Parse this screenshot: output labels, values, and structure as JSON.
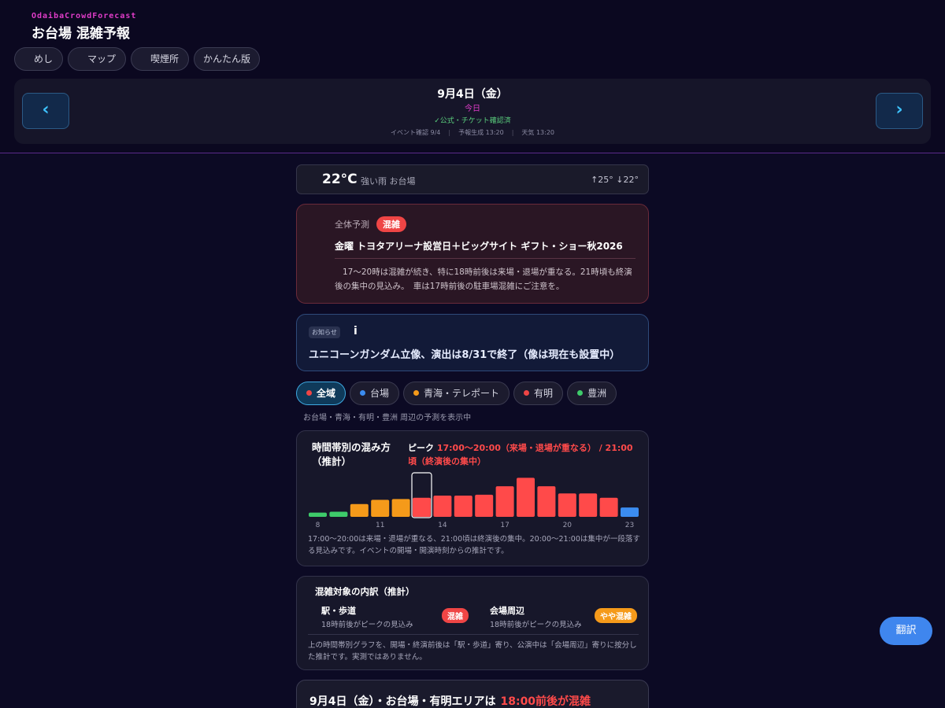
{
  "header": {
    "brand_en": "OdaibaCrowdForecast",
    "brand_ja": "お台場 混雑予報",
    "tabs": [
      {
        "label": "めし"
      },
      {
        "label": "マップ"
      },
      {
        "label": "喫煙所"
      },
      {
        "label": "かんたん版"
      }
    ]
  },
  "date_bar": {
    "prev": "‹",
    "next": "›",
    "date": "9月4日（金）",
    "today": "今日",
    "verified": "✓公式・チケット確認済",
    "event_check": "イベント確認 9/4",
    "forecast_generated": "予報生成 13:20",
    "weather_time": "天気 13:20"
  },
  "weather": {
    "temp": "22°C",
    "desc": "強い雨 お台場",
    "high_low": "↑25° ↓22°"
  },
  "overall": {
    "label": "全体予測",
    "level": "混雑",
    "title": "金曜 トヨタアリーナ設営日＋ビッグサイト ギフト・ショー秋2026",
    "body": "17〜20時は混雑が続き、特に18時前後は来場・退場が重なる。21時頃も終演後の集中の見込み。　車は17時前後の駐車場混雑にご注意を。"
  },
  "notice": {
    "tag": "お知らせ",
    "icon_text": "i",
    "text": "ユニコーンガンダム立像、演出は8/31で終了（像は現在も設置中）"
  },
  "areas": {
    "items": [
      {
        "label": "全域",
        "color": "#ef4545"
      },
      {
        "label": "台場",
        "color": "#3b8cf0"
      },
      {
        "label": "青海・テレポート",
        "color": "#f59a1a"
      },
      {
        "label": "有明",
        "color": "#ef4545"
      },
      {
        "label": "豊洲",
        "color": "#3ecb6a"
      }
    ],
    "note": "お台場・青海・有明・豊洲 周辺の予測を表示中"
  },
  "chart_data": {
    "type": "bar",
    "title": "時間帯別の混み方（推計）",
    "peak_label": "ピーク",
    "peak_value": "17:00〜20:00（来場・退場が重なる） / 21:00頃（終演後の集中）",
    "categories": [
      "8",
      "9",
      "10",
      "11",
      "12",
      "13",
      "14",
      "15",
      "16",
      "17",
      "18",
      "19",
      "20",
      "21",
      "22",
      "23"
    ],
    "values": [
      10,
      12,
      30,
      40,
      42,
      45,
      50,
      50,
      52,
      72,
      92,
      72,
      55,
      55,
      45,
      22
    ],
    "colors": [
      "#3ecb6a",
      "#3ecb6a",
      "#f59a1a",
      "#f59a1a",
      "#f59a1a",
      "#ff4a4a",
      "#ff4a4a",
      "#ff4a4a",
      "#ff4a4a",
      "#ff4a4a",
      "#ff4a4a",
      "#ff4a4a",
      "#ff4a4a",
      "#ff4a4a",
      "#ff4a4a",
      "#3b8cf0"
    ],
    "selected_index": 5,
    "tick_labels": [
      "8",
      "11",
      "14",
      "17",
      "20",
      "23"
    ],
    "ylim": [
      0,
      100
    ],
    "note": "17:00〜20:00は来場・退場が重なる、21:00頃は終演後の集中。20:00〜21:00は集中が一段落する見込みです。イベントの開場・開演時刻からの推計です。"
  },
  "breakdown": {
    "title": "混雑対象の内訳（推計）",
    "items": [
      {
        "name": "駅・歩道",
        "sub": "18時前後がピークの見込み",
        "badge": "混雑",
        "badge_color": "#ef4545"
      },
      {
        "name": "会場周辺",
        "sub": "18時前後がピークの見込み",
        "badge": "やや混雑",
        "badge_color": "#f59a1a"
      }
    ],
    "note": "上の時間帯別グラフを、開場・終演前後は「駅・歩道」寄り、公演中は「会場周辺」寄りに按分した推計です。実測ではありません。"
  },
  "summary": {
    "text": "9月4日（金）・お台場・有明エリアは",
    "highlight": "18:00前後が混雑"
  },
  "translate": {
    "label": "翻訳"
  }
}
